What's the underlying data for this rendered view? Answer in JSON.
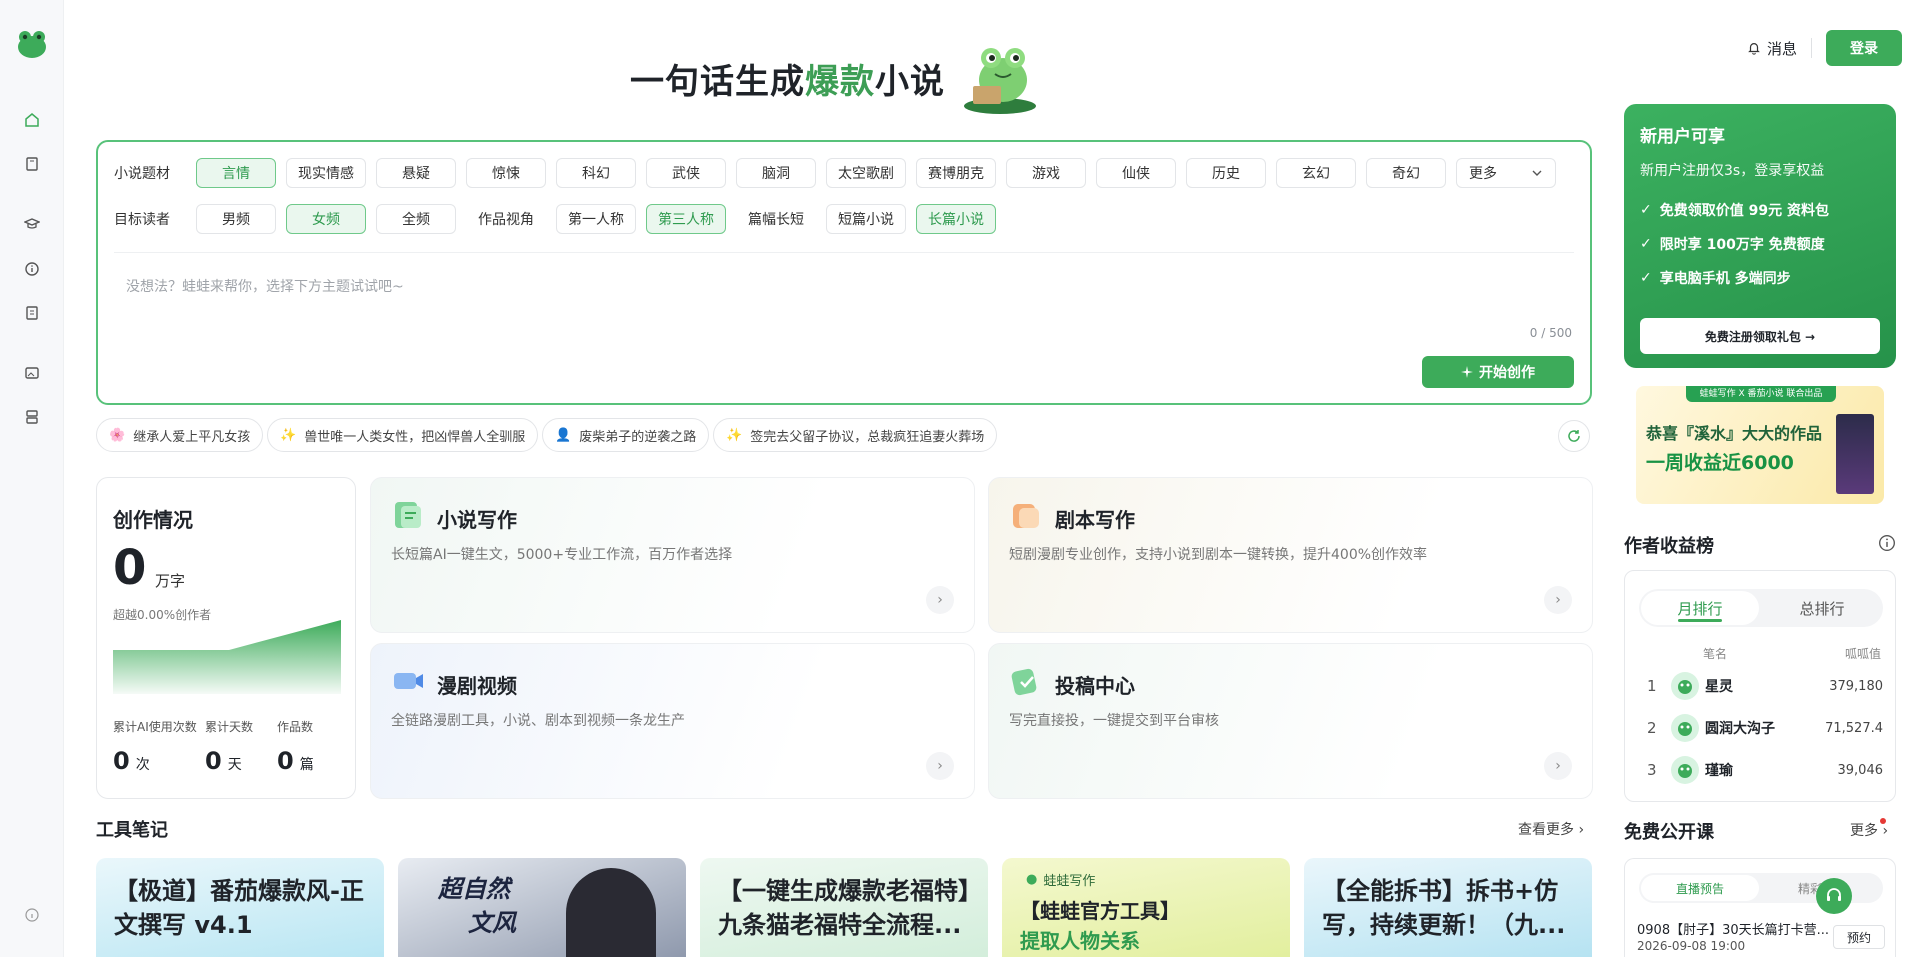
{
  "topbar": {
    "messages_label": "消息",
    "login_label": "登录"
  },
  "hero": {
    "title_pre": "一句话生成",
    "title_highlight": "爆款",
    "title_post": "小说"
  },
  "form": {
    "genre_label": "小说题材",
    "genres": [
      "言情",
      "现实情感",
      "悬疑",
      "惊悚",
      "科幻",
      "武侠",
      "脑洞",
      "太空歌剧",
      "赛博朋克",
      "游戏",
      "仙侠",
      "历史",
      "玄幻",
      "奇幻"
    ],
    "genre_more": "更多",
    "reader_label": "目标读者",
    "readers": [
      "男频",
      "女频",
      "全频"
    ],
    "view_label": "作品视角",
    "views": [
      "第一人称",
      "第三人称"
    ],
    "length_label": "篇幅长短",
    "lengths": [
      "短篇小说",
      "长篇小说"
    ],
    "placeholder": "没想法？蛙蛙来帮你，选择下方主题试试吧~",
    "count": "0 / 500",
    "start_label": "开始创作"
  },
  "suggestions": [
    "继承人爱上平凡女孩",
    "兽世唯一人类女性，把凶悍兽人全驯服",
    "废柴弟子的逆袭之路",
    "签完去父留子协议，总裁疯狂追妻火葬场"
  ],
  "stats": {
    "title": "创作情况",
    "words": "0",
    "words_unit": "万字",
    "rank_text": "超越0.00%创作者",
    "items": [
      {
        "label": "累计AI使用次数",
        "value": "0",
        "unit": "次"
      },
      {
        "label": "累计天数",
        "value": "0",
        "unit": "天"
      },
      {
        "label": "作品数",
        "value": "0",
        "unit": "篇"
      }
    ]
  },
  "cards": [
    {
      "title": "小说写作",
      "desc": "长短篇AI一键生文，5000+专业工作流，百万作者选择"
    },
    {
      "title": "剧本写作",
      "desc": "短剧漫剧专业创作，支持小说到剧本一键转换，提升400%创作效率"
    },
    {
      "title": "漫剧视频",
      "desc": "全链路漫剧工具，小说、剧本到视频一条龙生产"
    },
    {
      "title": "投稿中心",
      "desc": "写完直接投，一键提交到平台审核"
    }
  ],
  "notes": {
    "title": "工具笔记",
    "more": "查看更多",
    "items": [
      {
        "l1": "【极道】番茄爆款风-正",
        "l2": "文撰写 v4.1"
      },
      {
        "l1": "超自然",
        "l2": "文风"
      },
      {
        "l1": "【一键生成爆款老福特】",
        "l2": "九条猫老福特全流程..."
      },
      {
        "l1": "【蛙蛙官方工具】",
        "l2": "提取人物关系",
        "tag": "蛙蛙写作"
      },
      {
        "l1": "【全能拆书】拆书+仿",
        "l2": "写，持续更新！（九..."
      }
    ]
  },
  "promo": {
    "title": "新用户可享",
    "sub": "新用户注册仅3s，登录享权益",
    "items": [
      "免费领取价值 99元 资料包",
      "限时享 100万字 免费额度",
      "享电脑手机 多端同步"
    ],
    "button": "免费注册领取礼包 →"
  },
  "banner": {
    "top": "蛙蛙写作 X 番茄小说 联合出品",
    "line1": "恭喜『溪水』大大的作品",
    "line2": "一周收益近6000"
  },
  "ranking": {
    "title": "作者收益榜",
    "tabs": [
      "月排行",
      "总排行"
    ],
    "col_name": "笔名",
    "col_value": "呱呱值",
    "rows": [
      {
        "n": "1",
        "name": "星灵",
        "value": "379,180"
      },
      {
        "n": "2",
        "name": "圆润大沟子",
        "value": "71,527.4"
      },
      {
        "n": "3",
        "name": "瑾瑜",
        "value": "39,046"
      }
    ]
  },
  "courses": {
    "title": "免费公开课",
    "more": "更多",
    "tabs": [
      "直播预告",
      "精彩直播"
    ],
    "item_title": "0908【肘子】30天长篇打卡营...",
    "item_date": "2026-09-08 19:00",
    "item_btn": "预约"
  },
  "colors": {
    "brand": "#3dab5a",
    "brand_dark": "#2f9b4f",
    "highlight": "#3d9e55"
  }
}
